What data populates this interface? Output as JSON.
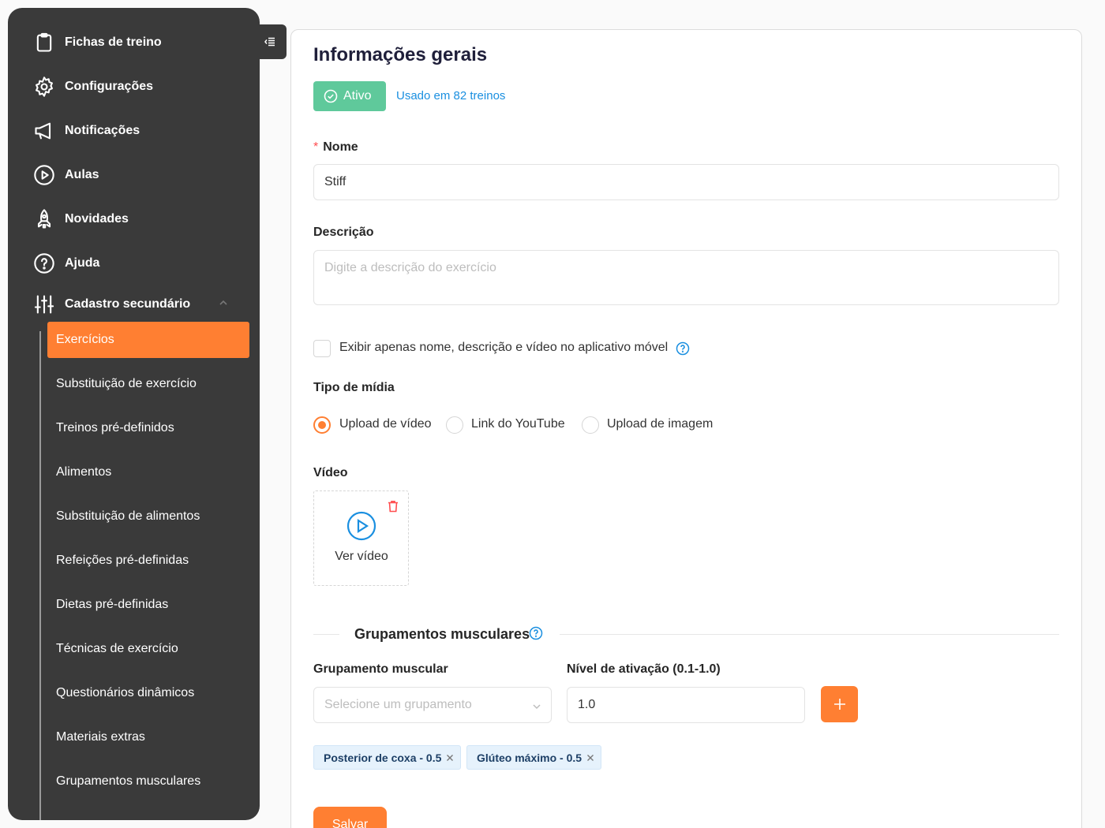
{
  "sidebar": {
    "items": [
      {
        "label": "Fichas de treino",
        "icon": "clipboard-icon"
      },
      {
        "label": "Configurações",
        "icon": "gear-icon"
      },
      {
        "label": "Notificações",
        "icon": "megaphone-icon"
      },
      {
        "label": "Aulas",
        "icon": "play-circle-icon"
      },
      {
        "label": "Novidades",
        "icon": "rocket-icon"
      },
      {
        "label": "Ajuda",
        "icon": "question-circle-icon"
      },
      {
        "label": "Cadastro secundário",
        "icon": "sliders-icon"
      }
    ],
    "subitems": [
      {
        "label": "Exercícios",
        "active": true
      },
      {
        "label": "Substituição de exercício"
      },
      {
        "label": "Treinos pré-definidos"
      },
      {
        "label": "Alimentos"
      },
      {
        "label": "Substituição de alimentos"
      },
      {
        "label": "Refeições pré-definidas"
      },
      {
        "label": "Dietas pré-definidas"
      },
      {
        "label": "Técnicas de exercício"
      },
      {
        "label": "Questionários dinâmicos"
      },
      {
        "label": "Materiais extras"
      },
      {
        "label": "Grupamentos musculares"
      }
    ]
  },
  "form": {
    "title": "Informações gerais",
    "status": "Ativo",
    "usage": "Usado em 82 treinos",
    "name_label": "Nome",
    "name_value": "Stiff",
    "desc_label": "Descrição",
    "desc_placeholder": "Digite a descrição do exercício",
    "mobile_only_label": "Exibir apenas nome, descrição e vídeo no aplicativo móvel",
    "media_type_label": "Tipo de mídia",
    "media_options": [
      "Upload de vídeo",
      "Link do YouTube",
      "Upload de imagem"
    ],
    "media_selected": "Upload de vídeo",
    "video_label": "Vídeo",
    "video_caption": "Ver vídeo",
    "muscle_section_title": "Grupamentos musculares",
    "muscle_group_label": "Grupamento muscular",
    "muscle_group_placeholder": "Selecione um grupamento",
    "activation_label": "Nível de ativação (0.1-1.0)",
    "activation_value": "1.0",
    "tags": [
      "Posterior de coxa - 0.5",
      "Glúteo máximo - 0.5"
    ],
    "save_label": "Salvar"
  },
  "colors": {
    "accent": "#ff7f32",
    "sidebar_bg": "#3a3a3a",
    "status_green": "#5fc99b",
    "link_blue": "#1a8fe0"
  }
}
